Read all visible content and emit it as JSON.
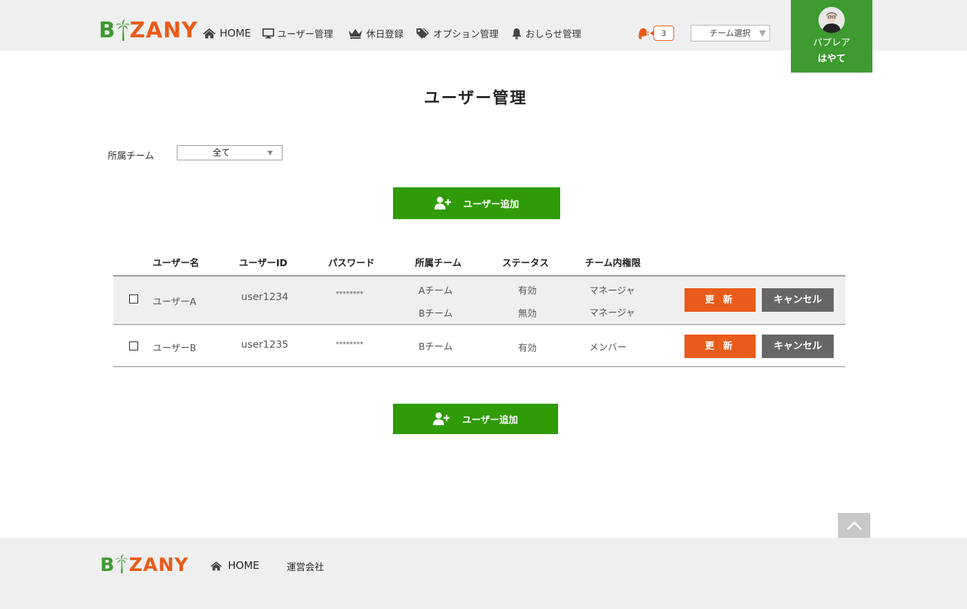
{
  "header": {
    "logo_text": "BIZANY",
    "nav": [
      {
        "label": "HOME",
        "icon": "home-icon"
      },
      {
        "label": "ユーザー管理",
        "icon": "monitor-icon"
      },
      {
        "label": "休日登録",
        "icon": "crown-icon"
      },
      {
        "label": "オプション管理",
        "icon": "tag-icon"
      },
      {
        "label": "おしらせ管理",
        "icon": "bell-icon"
      }
    ],
    "notification_count": "3",
    "team_select": "チーム選択",
    "user": {
      "company": "パプレア",
      "name": "はやて"
    }
  },
  "main": {
    "title": "ユーザー管理",
    "filter_label": "所属チーム",
    "filter_value": "全て",
    "add_button": "ユーザー追加",
    "table": {
      "headers": [
        "ユーザー名",
        "ユーザーID",
        "パスワード",
        "所属チーム",
        "ステータス",
        "チーム内権限"
      ],
      "rows": [
        {
          "name": "ユーザーA",
          "id": "user1234",
          "password": "********",
          "teams": [
            "Aチーム",
            "Bチーム"
          ],
          "statuses": [
            "有効",
            "無効"
          ],
          "roles": [
            "マネージャ",
            "マネージャ"
          ],
          "checked": false
        },
        {
          "name": "ユーザーB",
          "id": "user1235",
          "password": "********",
          "teams": [
            "Bチーム"
          ],
          "statuses": [
            "有効"
          ],
          "roles": [
            "メンバー"
          ],
          "checked": false
        }
      ],
      "update_label": "更 新",
      "cancel_label": "キャンセル"
    }
  },
  "footer": {
    "logo_text": "BIZANY",
    "home_label": "HOME",
    "company_label": "運営会社"
  },
  "colors": {
    "brand_green": "#3d9b2f",
    "brand_orange": "#e95b1a",
    "button_green": "#2f9b06",
    "cancel_gray": "#666666"
  }
}
